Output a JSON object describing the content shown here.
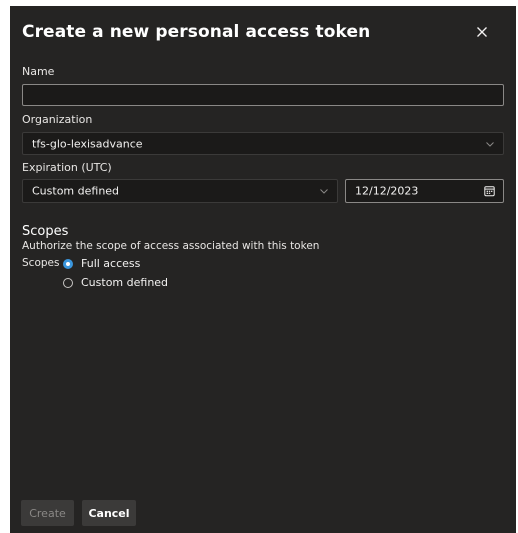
{
  "dialog": {
    "title": "Create a new personal access token",
    "close_icon": "close-icon"
  },
  "form": {
    "name": {
      "label": "Name",
      "value": "",
      "placeholder": ""
    },
    "organization": {
      "label": "Organization",
      "selected": "tfs-glo-lexisadvance"
    },
    "expiration": {
      "label": "Expiration (UTC)",
      "selected": "Custom defined",
      "date": "12/12/2023",
      "calendar_icon": "calendar-icon"
    }
  },
  "scopes": {
    "title": "Scopes",
    "description": "Authorize the scope of access associated with this token",
    "group_label": "Scopes",
    "options": [
      {
        "label": "Full access",
        "selected": true
      },
      {
        "label": "Custom defined",
        "selected": false
      }
    ]
  },
  "actions": {
    "create_label": "Create",
    "cancel_label": "Cancel"
  },
  "colors": {
    "dialog_bg": "#252423",
    "input_bg": "#1b1a19",
    "accent": "#3a96dd",
    "button_bg": "#3b3a39"
  }
}
